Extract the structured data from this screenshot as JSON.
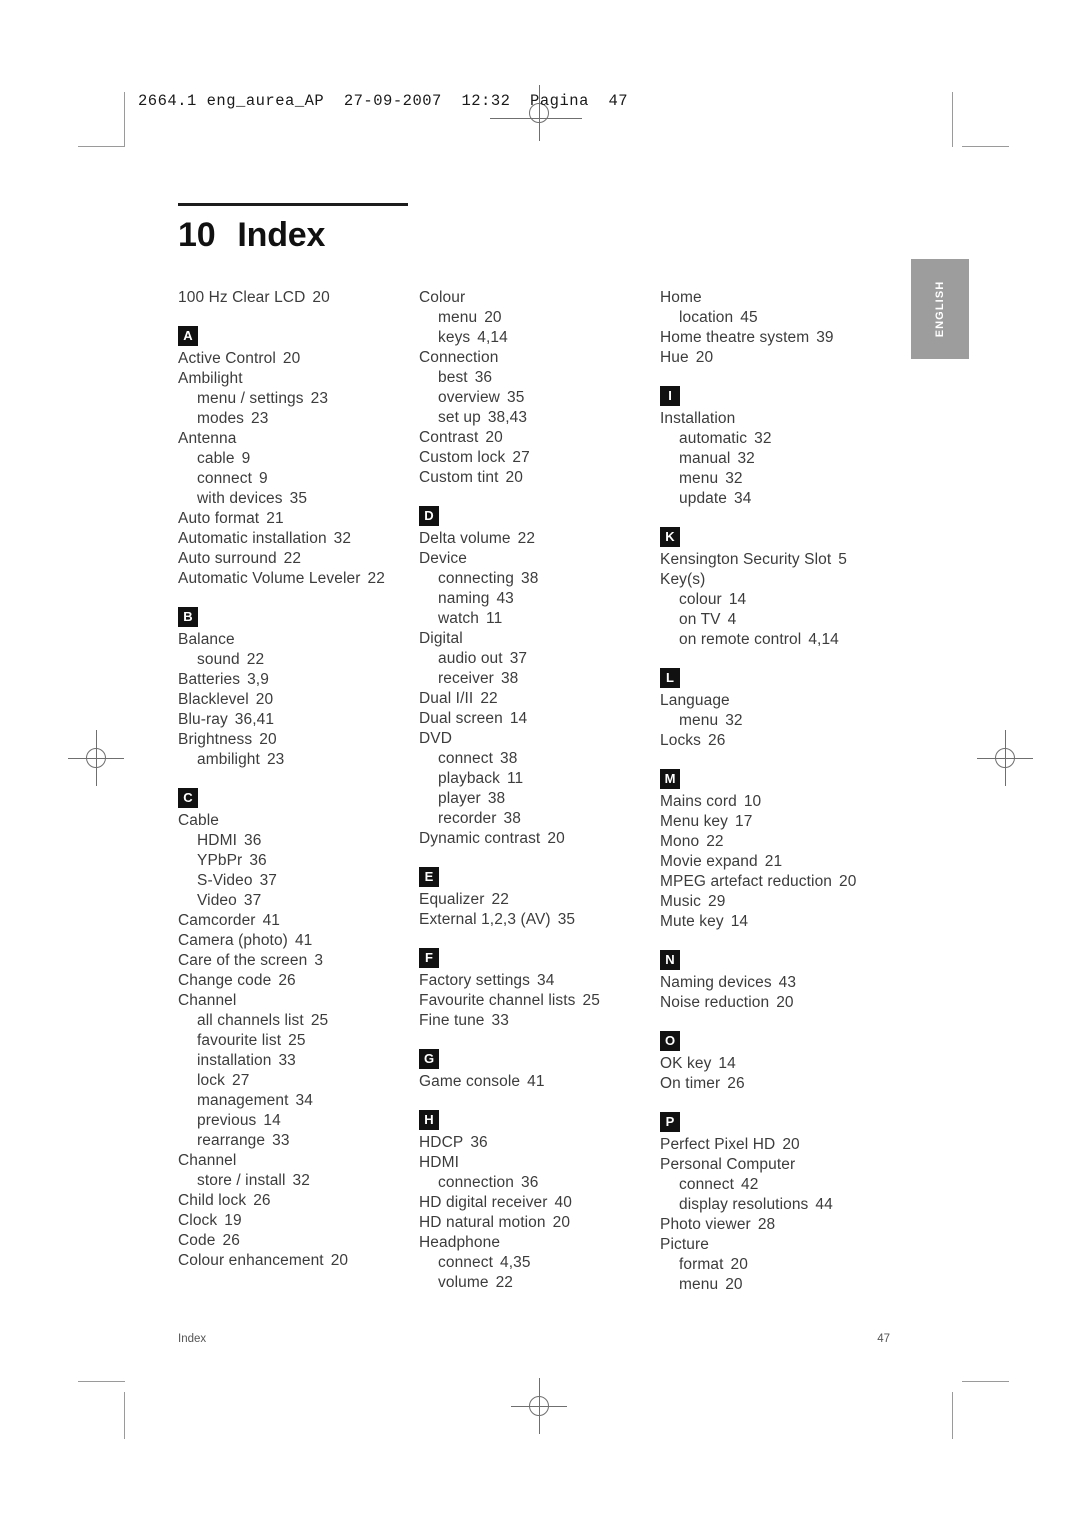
{
  "print_marks": {
    "slug_line": "2664.1 eng_aurea_AP  27-09-2007  12:32  Pagina  47"
  },
  "header": {
    "chapter_number": "10",
    "chapter_title": "Index"
  },
  "language_tab": {
    "label": "ENGLISH",
    "background_color": "#9d9d9d",
    "text_color": "#ffffff"
  },
  "footer": {
    "left": "Index",
    "page_number": "47"
  },
  "index": {
    "columns": [
      {
        "blocks": [
          {
            "type": "entries",
            "items": [
              {
                "indent": 0,
                "text": "100 Hz Clear LCD",
                "page": "20"
              }
            ]
          },
          {
            "type": "section",
            "letter": "A",
            "items": [
              {
                "indent": 0,
                "text": "Active Control",
                "page": "20"
              },
              {
                "indent": 0,
                "text": "Ambilight",
                "page": ""
              },
              {
                "indent": 1,
                "text": "menu / settings",
                "page": "23"
              },
              {
                "indent": 1,
                "text": "modes",
                "page": "23"
              },
              {
                "indent": 0,
                "text": "Antenna",
                "page": ""
              },
              {
                "indent": 1,
                "text": "cable",
                "page": "9"
              },
              {
                "indent": 1,
                "text": "connect",
                "page": "9"
              },
              {
                "indent": 1,
                "text": "with devices",
                "page": "35"
              },
              {
                "indent": 0,
                "text": "Auto format",
                "page": "21"
              },
              {
                "indent": 0,
                "text": "Automatic installation",
                "page": "32"
              },
              {
                "indent": 0,
                "text": "Auto surround",
                "page": "22"
              },
              {
                "indent": 0,
                "text": "Automatic Volume Leveler",
                "page": "22"
              }
            ]
          },
          {
            "type": "section",
            "letter": "B",
            "items": [
              {
                "indent": 0,
                "text": "Balance",
                "page": ""
              },
              {
                "indent": 1,
                "text": "sound",
                "page": "22"
              },
              {
                "indent": 0,
                "text": "Batteries",
                "page": "3,9"
              },
              {
                "indent": 0,
                "text": "Blacklevel",
                "page": "20"
              },
              {
                "indent": 0,
                "text": "Blu-ray",
                "page": "36,41"
              },
              {
                "indent": 0,
                "text": "Brightness",
                "page": "20"
              },
              {
                "indent": 1,
                "text": "ambilight",
                "page": "23"
              }
            ]
          },
          {
            "type": "section",
            "letter": "C",
            "items": [
              {
                "indent": 0,
                "text": "Cable",
                "page": ""
              },
              {
                "indent": 1,
                "text": "HDMI",
                "page": "36"
              },
              {
                "indent": 1,
                "text": "YPbPr",
                "page": "36"
              },
              {
                "indent": 1,
                "text": "S-Video",
                "page": "37"
              },
              {
                "indent": 1,
                "text": "Video",
                "page": "37"
              },
              {
                "indent": 0,
                "text": "Camcorder",
                "page": "41"
              },
              {
                "indent": 0,
                "text": "Camera (photo)",
                "page": "41"
              },
              {
                "indent": 0,
                "text": "Care of the screen",
                "page": "3"
              },
              {
                "indent": 0,
                "text": "Change code",
                "page": "26"
              },
              {
                "indent": 0,
                "text": "Channel",
                "page": ""
              },
              {
                "indent": 1,
                "text": "all channels list",
                "page": "25"
              },
              {
                "indent": 1,
                "text": "favourite list",
                "page": "25"
              },
              {
                "indent": 1,
                "text": "installation",
                "page": "33"
              },
              {
                "indent": 1,
                "text": "lock",
                "page": "27"
              },
              {
                "indent": 1,
                "text": "management",
                "page": "34"
              },
              {
                "indent": 1,
                "text": "previous",
                "page": "14"
              },
              {
                "indent": 1,
                "text": "rearrange",
                "page": "33"
              },
              {
                "indent": 0,
                "text": "Channel",
                "page": ""
              },
              {
                "indent": 1,
                "text": "store / install",
                "page": "32"
              },
              {
                "indent": 0,
                "text": "Child lock",
                "page": "26"
              },
              {
                "indent": 0,
                "text": "Clock",
                "page": "19"
              },
              {
                "indent": 0,
                "text": "Code",
                "page": "26"
              },
              {
                "indent": 0,
                "text": "Colour enhancement",
                "page": "20"
              }
            ]
          }
        ]
      },
      {
        "blocks": [
          {
            "type": "entries",
            "items": [
              {
                "indent": 0,
                "text": "Colour",
                "page": ""
              },
              {
                "indent": 1,
                "text": "menu",
                "page": "20"
              },
              {
                "indent": 1,
                "text": "keys",
                "page": "4,14"
              },
              {
                "indent": 0,
                "text": "Connection",
                "page": ""
              },
              {
                "indent": 1,
                "text": "best",
                "page": "36"
              },
              {
                "indent": 1,
                "text": "overview",
                "page": "35"
              },
              {
                "indent": 1,
                "text": "set up",
                "page": "38,43"
              },
              {
                "indent": 0,
                "text": "Contrast",
                "page": "20"
              },
              {
                "indent": 0,
                "text": "Custom lock",
                "page": "27"
              },
              {
                "indent": 0,
                "text": "Custom tint",
                "page": "20"
              }
            ]
          },
          {
            "type": "section",
            "letter": "D",
            "items": [
              {
                "indent": 0,
                "text": "Delta volume",
                "page": "22"
              },
              {
                "indent": 0,
                "text": "Device",
                "page": ""
              },
              {
                "indent": 1,
                "text": "connecting",
                "page": "38"
              },
              {
                "indent": 1,
                "text": "naming",
                "page": "43"
              },
              {
                "indent": 1,
                "text": "watch",
                "page": "11"
              },
              {
                "indent": 0,
                "text": "Digital",
                "page": ""
              },
              {
                "indent": 1,
                "text": "audio out",
                "page": "37"
              },
              {
                "indent": 1,
                "text": "receiver",
                "page": "38"
              },
              {
                "indent": 0,
                "text": "Dual I/II",
                "page": "22"
              },
              {
                "indent": 0,
                "text": "Dual screen",
                "page": "14"
              },
              {
                "indent": 0,
                "text": "DVD",
                "page": ""
              },
              {
                "indent": 1,
                "text": "connect",
                "page": "38"
              },
              {
                "indent": 1,
                "text": "playback",
                "page": "11"
              },
              {
                "indent": 1,
                "text": "player",
                "page": "38"
              },
              {
                "indent": 1,
                "text": "recorder",
                "page": "38"
              },
              {
                "indent": 0,
                "text": "Dynamic contrast",
                "page": "20"
              }
            ]
          },
          {
            "type": "section",
            "letter": "E",
            "items": [
              {
                "indent": 0,
                "text": "Equalizer",
                "page": "22"
              },
              {
                "indent": 0,
                "text": "External 1,2,3 (AV)",
                "page": "35"
              }
            ]
          },
          {
            "type": "section",
            "letter": "F",
            "items": [
              {
                "indent": 0,
                "text": "Factory settings",
                "page": "34"
              },
              {
                "indent": 0,
                "text": "Favourite channel lists",
                "page": "25"
              },
              {
                "indent": 0,
                "text": "Fine tune",
                "page": "33"
              }
            ]
          },
          {
            "type": "section",
            "letter": "G",
            "items": [
              {
                "indent": 0,
                "text": "Game console",
                "page": "41"
              }
            ]
          },
          {
            "type": "section",
            "letter": "H",
            "items": [
              {
                "indent": 0,
                "text": "HDCP",
                "page": "36"
              },
              {
                "indent": 0,
                "text": "HDMI",
                "page": ""
              },
              {
                "indent": 1,
                "text": "connection",
                "page": "36"
              },
              {
                "indent": 0,
                "text": "HD digital receiver",
                "page": "40"
              },
              {
                "indent": 0,
                "text": "HD natural motion",
                "page": "20"
              },
              {
                "indent": 0,
                "text": "Headphone",
                "page": ""
              },
              {
                "indent": 1,
                "text": "connect",
                "page": "4,35"
              },
              {
                "indent": 1,
                "text": "volume",
                "page": "22"
              }
            ]
          }
        ]
      },
      {
        "blocks": [
          {
            "type": "entries",
            "items": [
              {
                "indent": 0,
                "text": "Home",
                "page": ""
              },
              {
                "indent": 1,
                "text": "location",
                "page": "45"
              },
              {
                "indent": 0,
                "text": "Home theatre system",
                "page": "39"
              },
              {
                "indent": 0,
                "text": "Hue",
                "page": "20"
              }
            ]
          },
          {
            "type": "section",
            "letter": "I",
            "items": [
              {
                "indent": 0,
                "text": "Installation",
                "page": ""
              },
              {
                "indent": 1,
                "text": "automatic",
                "page": "32"
              },
              {
                "indent": 1,
                "text": "manual",
                "page": "32"
              },
              {
                "indent": 1,
                "text": "menu",
                "page": "32"
              },
              {
                "indent": 1,
                "text": "update",
                "page": "34"
              }
            ]
          },
          {
            "type": "section",
            "letter": "K",
            "items": [
              {
                "indent": 0,
                "text": "Kensington Security Slot",
                "page": "5"
              },
              {
                "indent": 0,
                "text": "Key(s)",
                "page": ""
              },
              {
                "indent": 1,
                "text": "colour",
                "page": "14"
              },
              {
                "indent": 1,
                "text": "on TV",
                "page": "4"
              },
              {
                "indent": 1,
                "text": "on remote control",
                "page": "4,14"
              }
            ]
          },
          {
            "type": "section",
            "letter": "L",
            "items": [
              {
                "indent": 0,
                "text": "Language",
                "page": ""
              },
              {
                "indent": 1,
                "text": "menu",
                "page": "32"
              },
              {
                "indent": 0,
                "text": "Locks",
                "page": "26"
              }
            ]
          },
          {
            "type": "section",
            "letter": "M",
            "items": [
              {
                "indent": 0,
                "text": "Mains cord",
                "page": "10"
              },
              {
                "indent": 0,
                "text": "Menu key",
                "page": "17"
              },
              {
                "indent": 0,
                "text": "Mono",
                "page": "22"
              },
              {
                "indent": 0,
                "text": "Movie expand",
                "page": "21"
              },
              {
                "indent": 0,
                "text": "MPEG artefact reduction",
                "page": "20"
              },
              {
                "indent": 0,
                "text": "Music",
                "page": "29"
              },
              {
                "indent": 0,
                "text": "Mute key",
                "page": "14"
              }
            ]
          },
          {
            "type": "section",
            "letter": "N",
            "items": [
              {
                "indent": 0,
                "text": "Naming devices",
                "page": "43"
              },
              {
                "indent": 0,
                "text": "Noise reduction",
                "page": "20"
              }
            ]
          },
          {
            "type": "section",
            "letter": "O",
            "items": [
              {
                "indent": 0,
                "text": "OK key",
                "page": "14"
              },
              {
                "indent": 0,
                "text": "On timer",
                "page": "26"
              }
            ]
          },
          {
            "type": "section",
            "letter": "P",
            "items": [
              {
                "indent": 0,
                "text": "Perfect Pixel HD",
                "page": "20"
              },
              {
                "indent": 0,
                "text": "Personal Computer",
                "page": ""
              },
              {
                "indent": 1,
                "text": "connect",
                "page": "42"
              },
              {
                "indent": 1,
                "text": "display resolutions",
                "page": "44"
              },
              {
                "indent": 0,
                "text": "Photo viewer",
                "page": "28"
              },
              {
                "indent": 0,
                "text": "Picture",
                "page": ""
              },
              {
                "indent": 1,
                "text": "format",
                "page": "20"
              },
              {
                "indent": 1,
                "text": "menu",
                "page": "20"
              }
            ]
          }
        ]
      }
    ]
  }
}
